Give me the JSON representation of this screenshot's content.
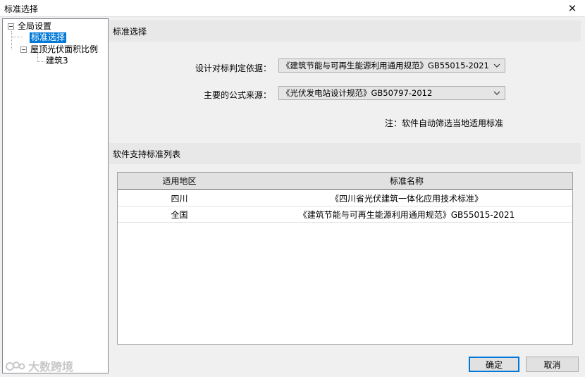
{
  "window": {
    "title": "标准选择",
    "close_glyph": "✕"
  },
  "tree": {
    "items": [
      {
        "label": "全局设置"
      },
      {
        "label": "标准选择"
      },
      {
        "label": "屋顶光伏面积比例"
      },
      {
        "label": "建筑3"
      }
    ]
  },
  "section1": {
    "title": "标准选择"
  },
  "form": {
    "basis_label": "设计对标判定依据：",
    "basis_value": "《建筑节能与可再生能源利用通用规范》GB55015-2021",
    "formula_label": "主要的公式来源：",
    "formula_value": "《光伏发电站设计规范》GB50797-2012",
    "note": "注：软件自动筛选当地适用标准"
  },
  "section2": {
    "title": "软件支持标准列表"
  },
  "table": {
    "columns": [
      "适用地区",
      "标准名称"
    ],
    "rows": [
      {
        "region": "四川",
        "standard": "《四川省光伏建筑一体化应用技术标准》"
      },
      {
        "region": "全国",
        "standard": "《建筑节能与可再生能源利用通用规范》GB55015-2021"
      }
    ]
  },
  "buttons": {
    "ok": "确定",
    "cancel": "取消"
  },
  "watermark": {
    "text": "大数跨境"
  },
  "colors": {
    "selection": "#0078d7",
    "default_button_border": "#0078d7"
  },
  "icons": {
    "close": "close-icon",
    "expander": "collapse-icon",
    "dropdown": "chevron-down-icon",
    "watermark": "watermark-logo-icon"
  }
}
